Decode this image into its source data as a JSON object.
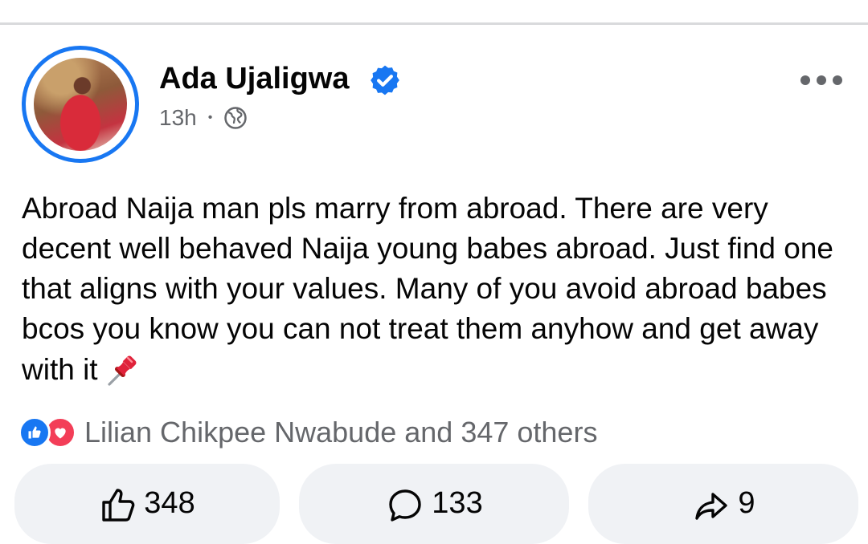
{
  "post": {
    "author": "Ada Ujaligwa",
    "time": "13h",
    "separator": "•",
    "text": "Abroad Naija man pls marry from abroad. There are very decent well behaved Naija young babes abroad. Just find one that aligns with your values. Many of you avoid abroad babes bcos you know you can not treat them anyhow and get away with it"
  },
  "icons": {
    "verified": "verified-badge-icon",
    "audience": "globe-icon",
    "menu": "more-options-icon",
    "pin": "pushpin-emoji-icon",
    "like": "thumbs-up-icon",
    "comment": "comment-bubble-icon",
    "share": "share-arrow-icon"
  },
  "reactions": {
    "summary": "Lilian Chikpee Nwabude and 347 others"
  },
  "actions": {
    "like_count": "348",
    "comment_count": "133",
    "share_count": "9"
  },
  "colors": {
    "brand_blue": "#1877f2",
    "love_red": "#f33e58",
    "secondary_text": "#65676b",
    "button_bg": "#f0f2f5"
  }
}
